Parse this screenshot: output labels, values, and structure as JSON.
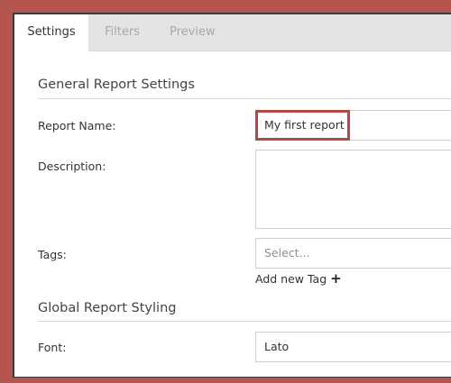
{
  "tabs": [
    {
      "label": "Settings",
      "active": true
    },
    {
      "label": "Filters",
      "active": false
    },
    {
      "label": "Preview",
      "active": false
    }
  ],
  "general_section": {
    "title": "General Report Settings",
    "report_name": {
      "label": "Report Name:",
      "value": "My first report"
    },
    "description": {
      "label": "Description:",
      "value": ""
    },
    "tags": {
      "label": "Tags:",
      "placeholder": "Select...",
      "add_label": "Add new Tag",
      "add_icon": "plus-icon"
    }
  },
  "styling_section": {
    "title": "Global Report Styling",
    "font": {
      "label": "Font:",
      "value": "Lato"
    }
  },
  "colors": {
    "frame_accent": "#b4564d",
    "highlight_border": "#b14a41",
    "tab_bar": "#e4e4e4"
  }
}
